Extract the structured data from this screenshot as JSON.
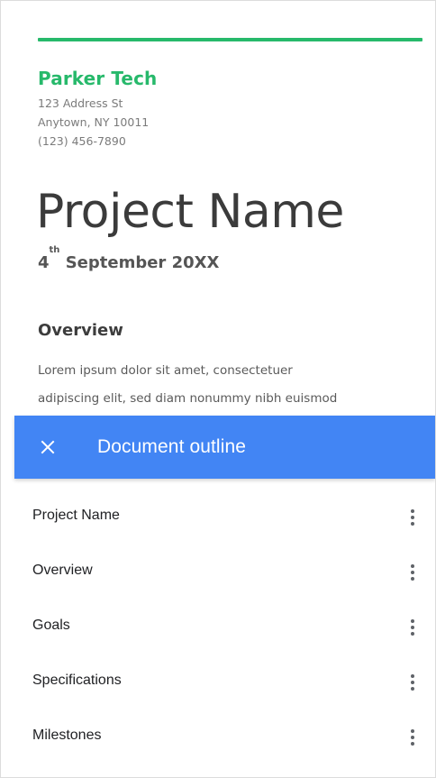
{
  "document": {
    "company_name": "Parker Tech",
    "address": [
      "123 Address St",
      "Anytown, NY 10011",
      "(123) 456-7890"
    ],
    "title": "Project Name",
    "date": {
      "day": "4",
      "suffix": "th",
      "rest": " September 20XX"
    },
    "overview": {
      "heading": "Overview",
      "lines": [
        "Lorem ipsum dolor sit amet, consectetuer",
        "adipiscing elit, sed diam nonummy nibh euismod"
      ]
    }
  },
  "outline": {
    "title": "Document outline",
    "close_icon": "close-icon",
    "more_icon": "more-vert-icon",
    "items": [
      {
        "label": "Project Name"
      },
      {
        "label": "Overview"
      },
      {
        "label": "Goals"
      },
      {
        "label": "Specifications"
      },
      {
        "label": "Milestones"
      }
    ]
  },
  "colors": {
    "accent_green": "#27b96b",
    "header_blue": "#4285f4",
    "body_text": "#3b3b3b",
    "list_text": "#202124"
  }
}
